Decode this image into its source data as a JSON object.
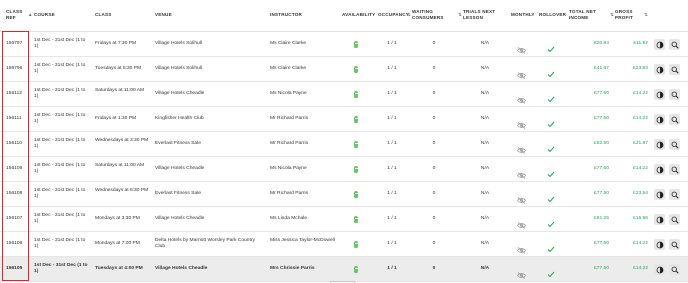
{
  "headers": {
    "class_ref": "CLASS REF",
    "course": "COURSE",
    "class": "CLASS",
    "venue": "VENUE",
    "instructor": "INSTRUCTOR",
    "availability": "AVAILABILITY",
    "occupancy": "OCCUPANCY",
    "waiting": "WAITING CONSUMERS",
    "trials": "TRIALS NEXT LESSON",
    "monthly": "MONTHLY",
    "rollover": "ROLLOVER",
    "total_net_income": "TOTAL NET INCOME",
    "gross_profit": "GROSS PROFIT"
  },
  "rows": [
    {
      "ref": "156797",
      "course": "1st Dec - 31st Dec (1 to 1)",
      "class": "Fridays at 7:30 PM",
      "venue": "Village Hotels Solihull",
      "instructor": "Ms Claire Clarke",
      "occupancy": "1 / 1",
      "waiting": "0",
      "trials": "N/A",
      "income": "£20.84",
      "profit": "£11.92"
    },
    {
      "ref": "156796",
      "course": "1st Dec - 31st Dec (1 to 1)",
      "class": "Tuesdays at 5:30 PM",
      "venue": "Village Hotels Solihull",
      "instructor": "Ms Claire Clarke",
      "occupancy": "1 / 1",
      "waiting": "0",
      "trials": "N/A",
      "income": "£41.67",
      "profit": "£23.83"
    },
    {
      "ref": "156112",
      "course": "1st Dec - 31st Dec (1 to 1)",
      "class": "Saturdays at 11:00 AM",
      "venue": "Village Hotels Cheadle",
      "instructor": "Ms Nicola Payne",
      "occupancy": "1 / 1",
      "waiting": "0",
      "trials": "N/A",
      "income": "£77.50",
      "profit": "£14.22"
    },
    {
      "ref": "156111",
      "course": "1st Dec - 31st Dec (1 to 1)",
      "class": "Fridays at 1:30 PM",
      "venue": "Kingfisher Health Club",
      "instructor": "Mr Richard Parris",
      "occupancy": "1 / 1",
      "waiting": "0",
      "trials": "N/A",
      "income": "£77.50",
      "profit": "£14.22"
    },
    {
      "ref": "156110",
      "course": "1st Dec - 31st Dec (1 to 1)",
      "class": "Wednesdays at 3:30 PM",
      "venue": "Everlast Fitness Sale",
      "instructor": "Mr Richard Parris",
      "occupancy": "1 / 1",
      "waiting": "0",
      "trials": "N/A",
      "income": "£82.50",
      "profit": "£21.87"
    },
    {
      "ref": "156109",
      "course": "1st Dec - 31st Dec (1 to 1)",
      "class": "Saturdays at 11:00 AM",
      "venue": "Village Hotels Cheadle",
      "instructor": "Ms Nicola Payne",
      "occupancy": "1 / 1",
      "waiting": "0",
      "trials": "N/A",
      "income": "£77.50",
      "profit": "£14.22"
    },
    {
      "ref": "156108",
      "course": "1st Dec - 31st Dec (1 to 1)",
      "class": "Wednesdays at 6:30 PM",
      "venue": "Everlast Fitness Sale",
      "instructor": "Mr Richard Parris",
      "occupancy": "1 / 1",
      "waiting": "0",
      "trials": "N/A",
      "income": "£77.50",
      "profit": "£23.54"
    },
    {
      "ref": "156107",
      "course": "1st Dec - 31st Dec (1 to 1)",
      "class": "Mondays at 3:30 PM",
      "venue": "Village Hotels Cheadle",
      "instructor": "Ms Linda Mchale",
      "occupancy": "1 / 1",
      "waiting": "0",
      "trials": "N/A",
      "income": "£81.25",
      "profit": "£15.96"
    },
    {
      "ref": "156106",
      "course": "1st Dec - 31st Dec (1 to 1)",
      "class": "Mondays at 7:00 PM",
      "venue": "Delta Hotels by Marriott Worsley Park Country Club",
      "instructor": "Miss Jessica Taylor-McDowell",
      "occupancy": "1 / 1",
      "waiting": "0",
      "trials": "N/A",
      "income": "£77.50",
      "profit": "£14.22"
    },
    {
      "ref": "156105",
      "course": "1st Dec - 31st Dec (1 to 1)",
      "class": "Tuesdays at 4:00 PM",
      "venue": "Village Hotels Cheadle",
      "instructor": "Mrs Chrissie Parris",
      "occupancy": "1 / 1",
      "waiting": "0",
      "trials": "N/A",
      "income": "£77.50",
      "profit": "£14.22"
    }
  ],
  "selected_row": 9,
  "colors": {
    "accent_green": "#26a35a",
    "availability_green": "#6cc36c",
    "highlight_red": "#e02424",
    "selected_bg": "#ececec"
  },
  "icons": {
    "availability": "battery-icon",
    "monthly": "eye-off-icon",
    "rollover": "check-icon",
    "action1": "contrast-circle-icon",
    "action2": "search-icon"
  }
}
